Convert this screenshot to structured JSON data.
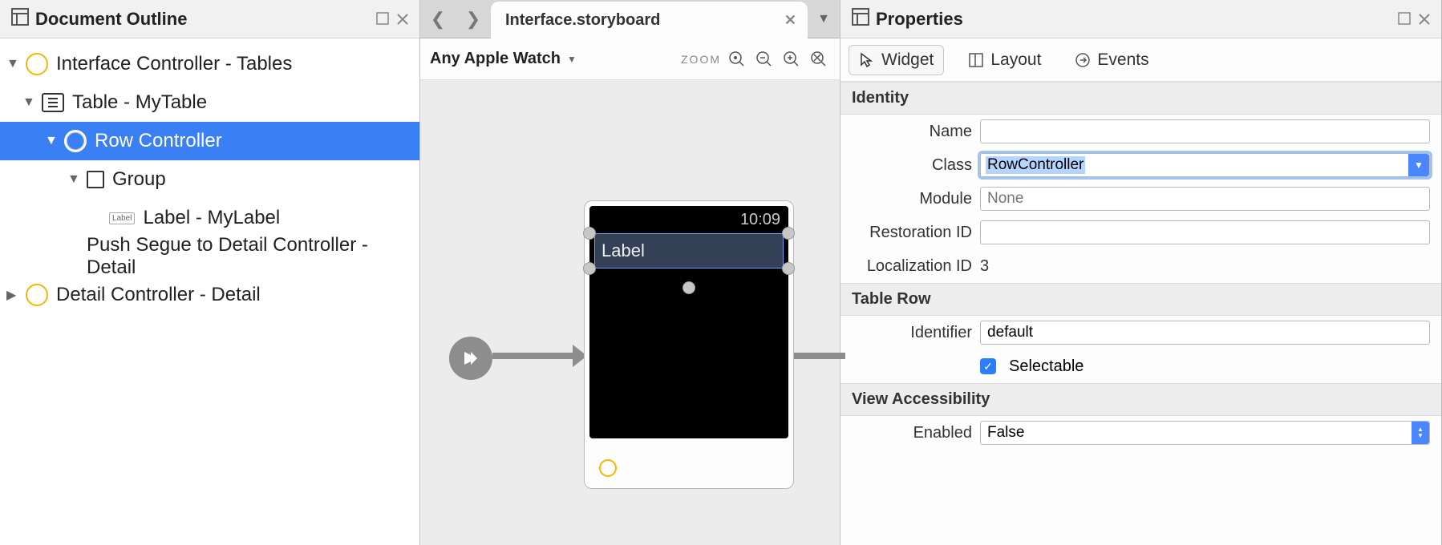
{
  "left": {
    "title": "Document Outline",
    "tree": {
      "n0": "Interface Controller - Tables",
      "n1": "Table - MyTable",
      "n2": "Row Controller",
      "n3": "Group",
      "n4_badge": "Label",
      "n4": "Label - MyLabel",
      "n5": "Push Segue to Detail Controller - Detail",
      "n6": "Detail Controller - Detail"
    }
  },
  "center": {
    "tab": "Interface.storyboard",
    "device": "Any Apple Watch",
    "zoom_label": "ZOOM",
    "watch": {
      "time": "10:09",
      "label": "Label"
    }
  },
  "right": {
    "title": "Properties",
    "tabs": {
      "widget": "Widget",
      "layout": "Layout",
      "events": "Events"
    },
    "identity": {
      "header": "Identity",
      "name_label": "Name",
      "name_value": "",
      "class_label": "Class",
      "class_value": "RowController",
      "module_label": "Module",
      "module_placeholder": "None",
      "restoration_label": "Restoration ID",
      "restoration_value": "",
      "localization_label": "Localization ID",
      "localization_value": "3"
    },
    "tablerow": {
      "header": "Table Row",
      "identifier_label": "Identifier",
      "identifier_value": "default",
      "selectable_label": "Selectable"
    },
    "acc": {
      "header": "View Accessibility",
      "enabled_label": "Enabled",
      "enabled_value": "False"
    }
  }
}
